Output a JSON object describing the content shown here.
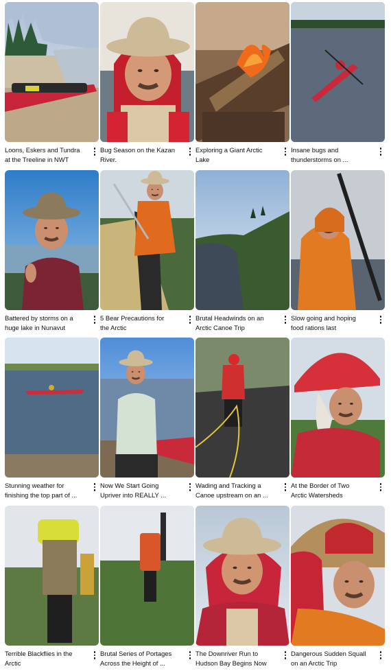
{
  "videos": [
    {
      "title": "Loons, Eskers and Tundra\nat the Treeline in NWT",
      "scene": "kayak-shore"
    },
    {
      "title": "Bug Season on the Kazan\nRiver.",
      "scene": "man-selfie-red"
    },
    {
      "title": "Exploring a Giant Arctic\nLake",
      "scene": "campfire"
    },
    {
      "title": "Insane bugs and\nthunderstorms on ...",
      "scene": "kayak-water"
    },
    {
      "title": "Battered by storms on a\nhuge lake in Nunavut",
      "scene": "man-hat-lake"
    },
    {
      "title": "5 Bear Precautions for\nthe Arctic",
      "scene": "man-tent-gun"
    },
    {
      "title": "Brutal Headwinds on an\nArctic Canoe Trip",
      "scene": "river-landscape"
    },
    {
      "title": "Slow going and hoping\nfood rations last",
      "scene": "paddler-orange"
    },
    {
      "title": "Stunning weather for\nfinishing the top part of ...",
      "scene": "kayak-far"
    },
    {
      "title": "Now We Start Going\nUpriver into REALLY ...",
      "scene": "man-shore-talk"
    },
    {
      "title": "Wading and Tracking a\nCanoe upstream on an ...",
      "scene": "wading-rope"
    },
    {
      "title": "At the Border of Two\nArctic Watersheds",
      "scene": "helmet-red"
    },
    {
      "title": "Terrible Blackflies in the\nArctic",
      "scene": "hiker-yellow-pack"
    },
    {
      "title": "Brutal Series of Portages\nAcross the Height of ...",
      "scene": "hiker-red-pack"
    },
    {
      "title": "The Downriver Run to\nHudson Bay Begins Now",
      "scene": "man-hat-bandana"
    },
    {
      "title": "Dangerous Sudden Squall\non an Arctic Trip",
      "scene": "man-closeup-orange"
    }
  ],
  "more_actions_icon": "more-vert-icon",
  "colors": {
    "title_text": "#0f0f0f",
    "background": "#ffffff"
  }
}
